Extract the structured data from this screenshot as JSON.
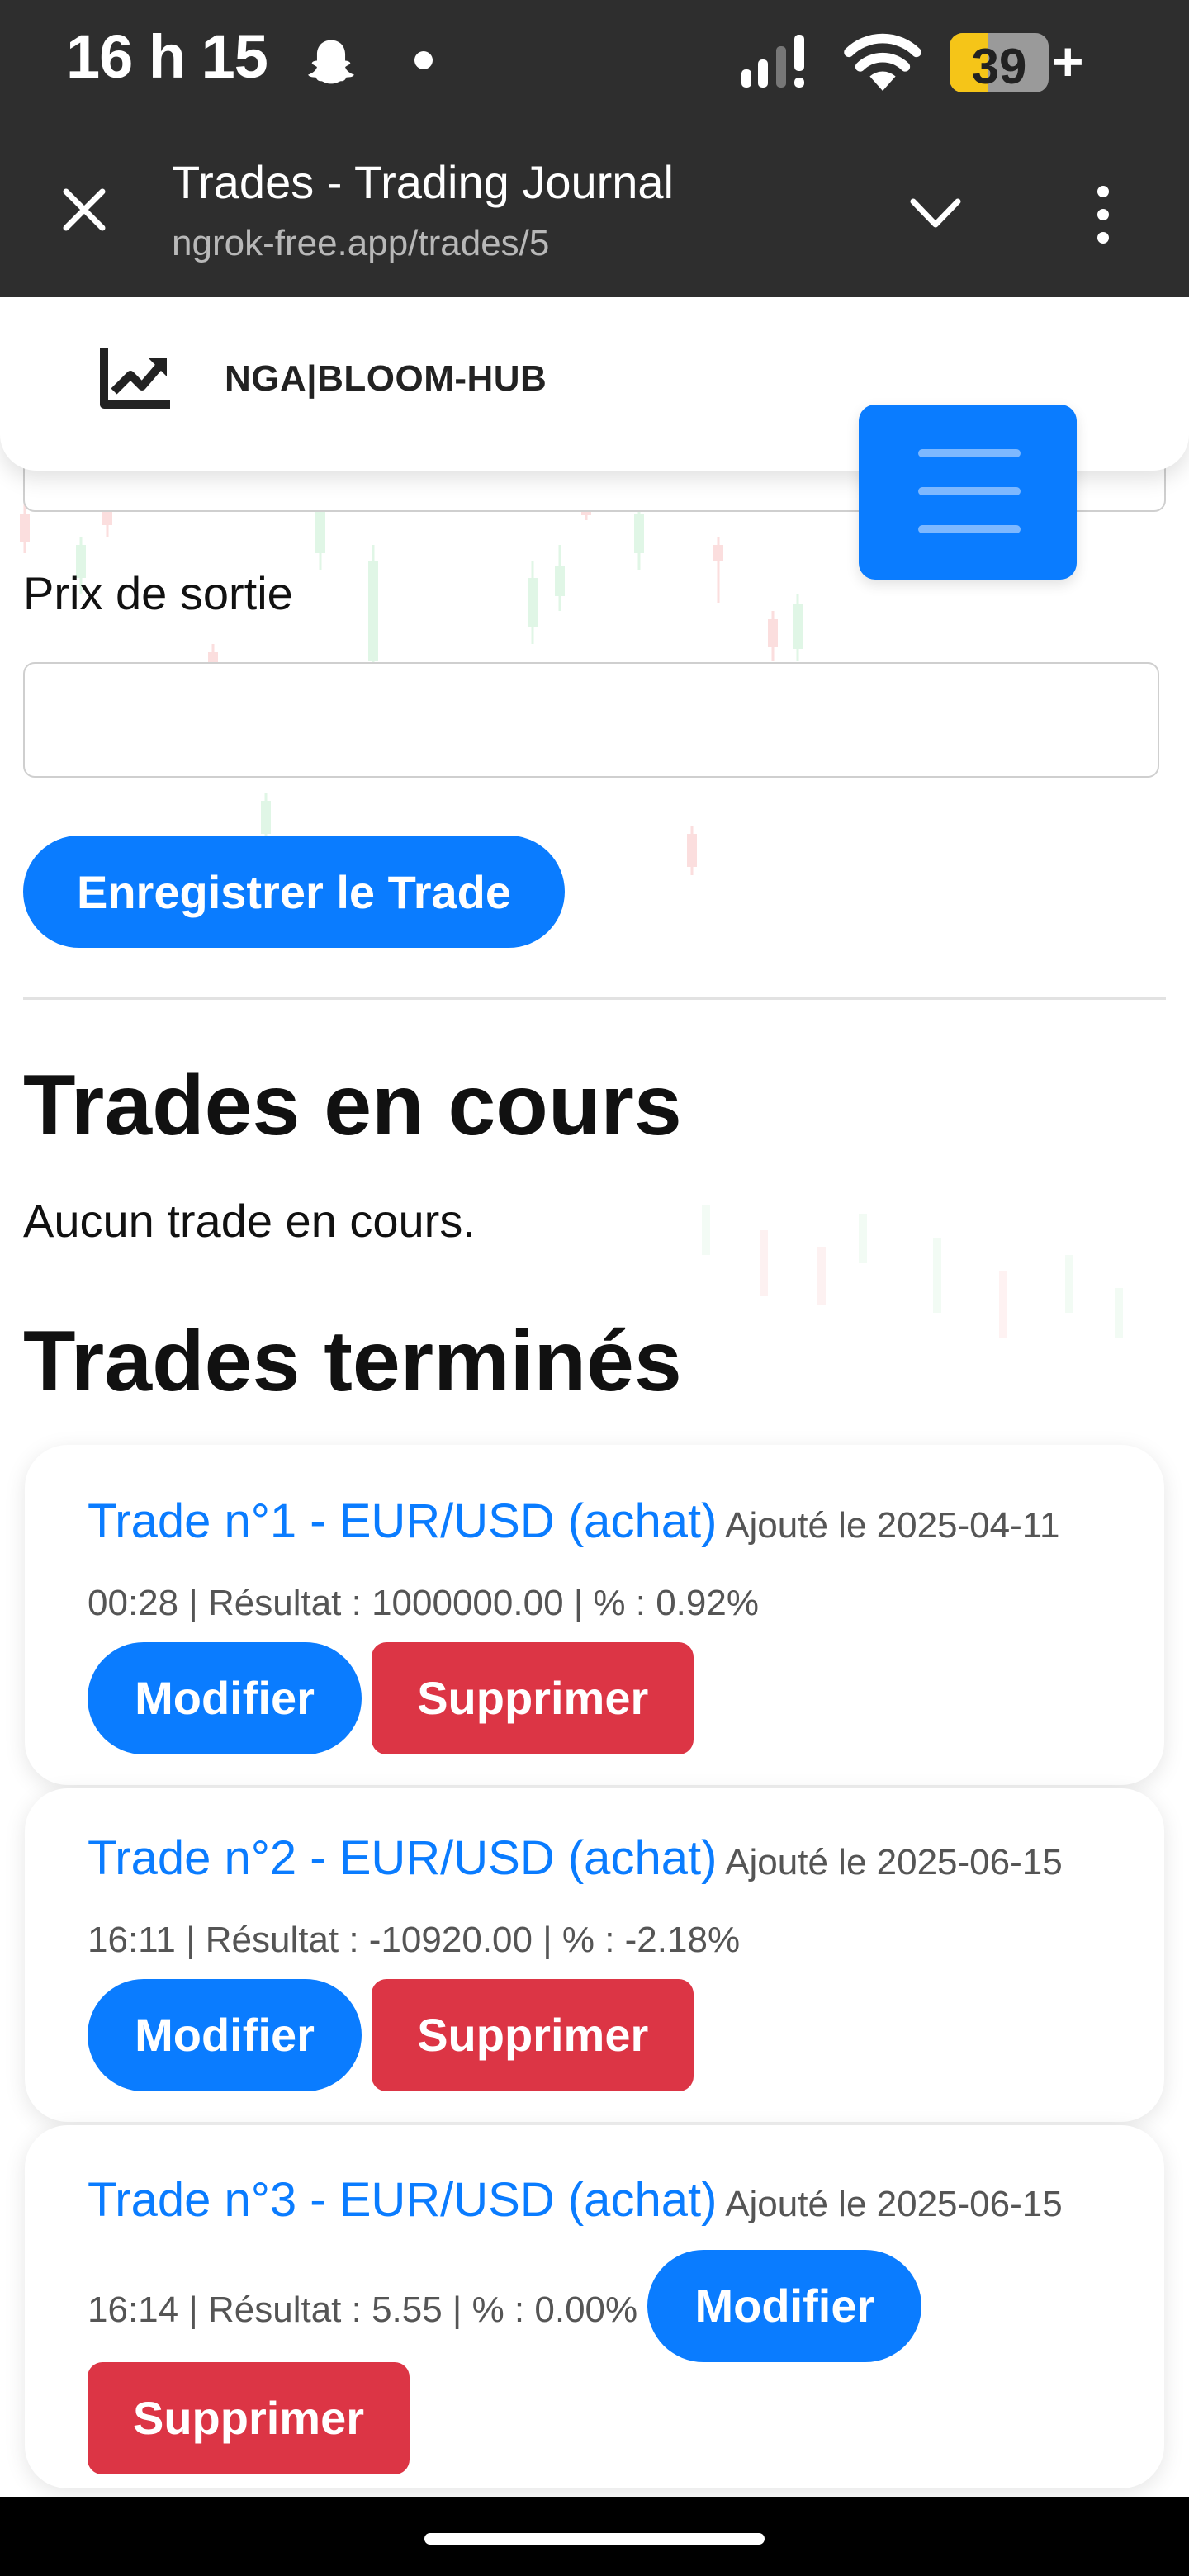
{
  "status_bar": {
    "time": "16 h 15",
    "battery": "39",
    "battery_level": 0.39,
    "battery_plus": "+"
  },
  "browser": {
    "title": "Trades - Trading Journal",
    "url": "ngrok-free.app/trades/5"
  },
  "nav": {
    "brand": "NGA|BLOOM-HUB"
  },
  "form": {
    "exit_price_label": "Prix de sortie",
    "exit_price_value": "",
    "save_label": "Enregistrer le Trade"
  },
  "current": {
    "heading": "Trades en cours",
    "empty_text": "Aucun trade en cours."
  },
  "done": {
    "heading": "Trades terminés",
    "trades": [
      {
        "title": "Trade n°1 - EUR/USD (achat)",
        "meta": "Ajouté le 2025-04-11 00:28 | Résultat : 1000000.00 | % : 0.92%",
        "edit_label": "Modifier",
        "delete_label": "Supprimer"
      },
      {
        "title": "Trade n°2 - EUR/USD (achat)",
        "meta": "Ajouté le 2025-06-15 16:11 | Résultat : -10920.00 | % : -2.18%",
        "edit_label": "Modifier",
        "delete_label": "Supprimer"
      },
      {
        "title": "Trade n°3 - EUR/USD (achat)",
        "meta": "Ajouté le 2025-06-15 16:14 | Résultat : 5.55 | % : 0.00%",
        "edit_label": "Modifier",
        "delete_label": "Supprimer"
      }
    ]
  },
  "colors": {
    "primary": "#0a7cff",
    "danger": "#dc3545",
    "chrome": "#2e2e2e"
  }
}
